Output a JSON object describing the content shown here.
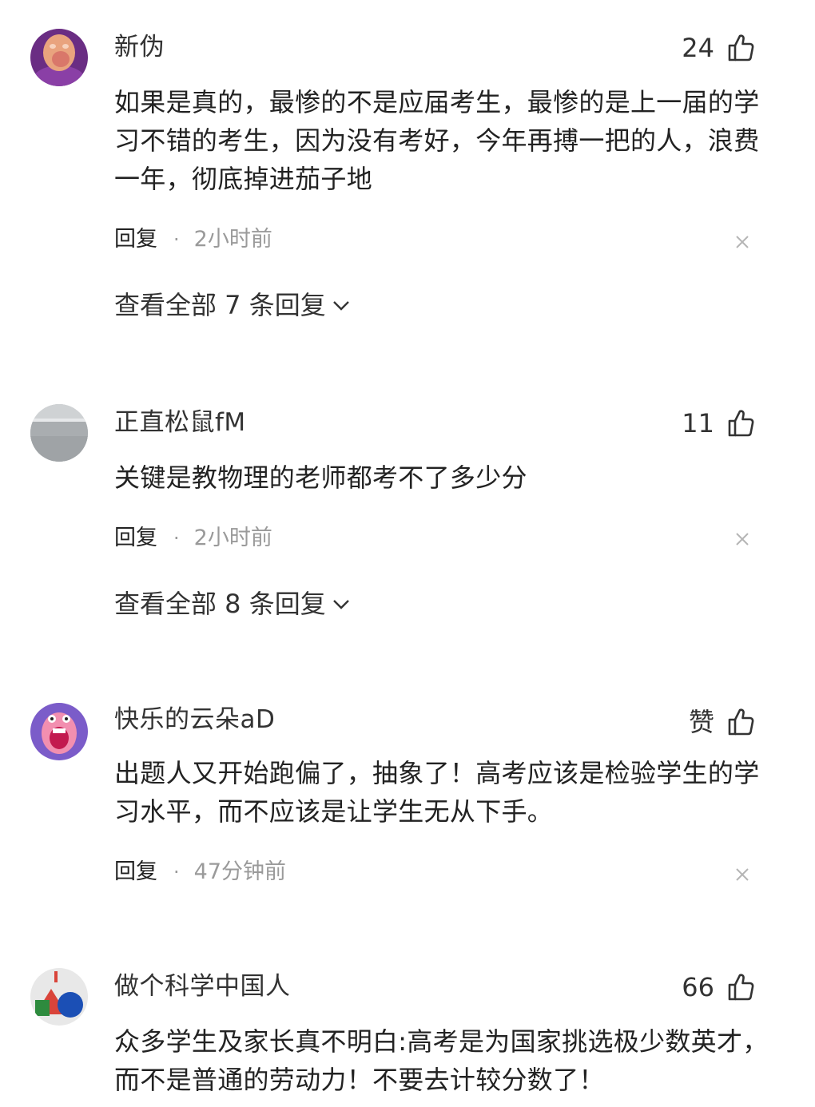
{
  "comments": [
    {
      "username": "新伪",
      "likes": "24",
      "text": "如果是真的，最惨的不是应届考生，最惨的是上一届的学习不错的考生，因为没有考好，今年再搏一把的人，浪费一年，彻底掉进茄子地",
      "reply_label": "回复",
      "separator": "·",
      "time": "2小时前",
      "view_all": "查看全部 7 条回复"
    },
    {
      "username": "正直松鼠fM",
      "likes": "11",
      "text": "关键是教物理的老师都考不了多少分",
      "reply_label": "回复",
      "separator": "·",
      "time": "2小时前",
      "view_all": "查看全部 8 条回复"
    },
    {
      "username": "快乐的云朵aD",
      "likes": "赞",
      "text": "出题人又开始跑偏了，抽象了！高考应该是检验学生的学习水平，而不应该是让学生无从下手。",
      "reply_label": "回复",
      "separator": "·",
      "time": "47分钟前"
    },
    {
      "username": "做个科学中国人",
      "likes": "66",
      "text": "众多学生及家长真不明白:高考是为国家挑选极少数英才，而不是普通的劳动力！不要去计较分数了！"
    }
  ],
  "icons": {
    "like": "thumbs-up-icon",
    "close": "close-icon",
    "expand": "chevron-down-icon"
  },
  "colors": {
    "text_primary": "#222222",
    "text_secondary": "#9a9a9a",
    "background": "#ffffff"
  }
}
